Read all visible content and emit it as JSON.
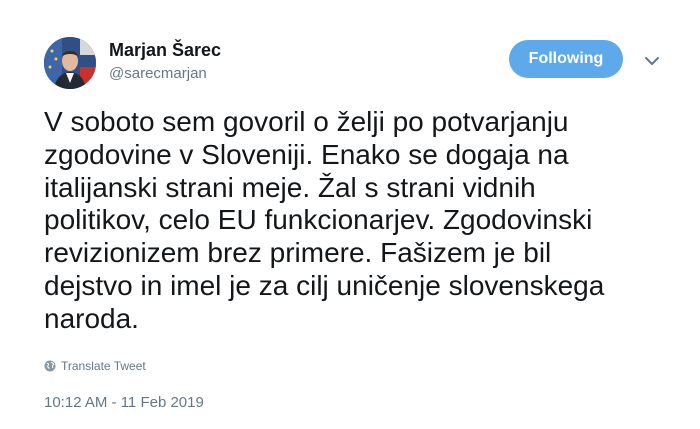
{
  "user": {
    "name": "Marjan Šarec",
    "handle": "@sarecmarjan"
  },
  "follow_button": {
    "label": "Following"
  },
  "tweet": {
    "lines": [
      "V soboto sem govoril o želji po potvarjanju",
      "zgodovine v Sloveniji. Enako se dogaja na",
      "italijanski strani meje. Žal s strani vidnih",
      "politikov, celo EU funkcionarjev. Zgodovinski",
      "revizionizem brez primere. Fašizem je bil",
      "dejstvo in imel je za cilj uničenje slovenskega",
      "naroda."
    ],
    "translate_label": "Translate Tweet",
    "timestamp": "10:12 AM - 11 Feb 2019"
  },
  "colors": {
    "accent": "#5da9e9",
    "text": "#14171a",
    "muted": "#657786"
  },
  "icons": {
    "avatar": "profile-photo",
    "more": "chevron-down-icon",
    "translate": "globe-icon"
  }
}
